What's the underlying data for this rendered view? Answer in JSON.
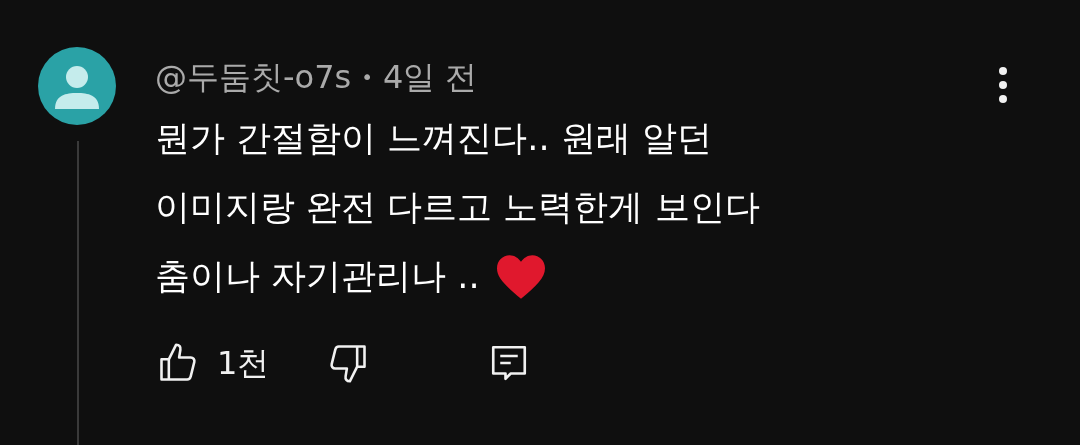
{
  "comment": {
    "author": "@두둠칫-o7s",
    "separator": "•",
    "time": "4일 전",
    "lines": [
      "뭔가 간절함이 느껴진다.. 원래 알던",
      "이미지랑 완전 다르고 노력한게 보인다",
      "춤이나 자기관리나 .."
    ],
    "like_count": "1천"
  }
}
